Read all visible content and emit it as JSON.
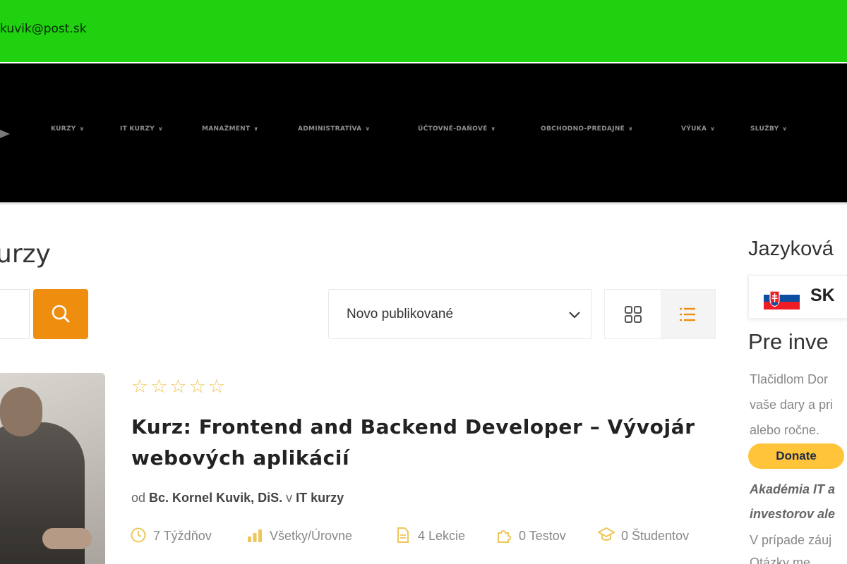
{
  "topbar": {
    "email": "kuvik@post.sk"
  },
  "nav": {
    "items": [
      {
        "label": "KURZY"
      },
      {
        "label": "IT KURZY"
      },
      {
        "label": "MANAŽMENT"
      },
      {
        "label": "ADMINISTRATÍVA"
      },
      {
        "label": "ÚČTOVNÉ-DAŇOVÉ"
      },
      {
        "label": "OBCHODNO-PREDAJNÉ"
      },
      {
        "label": "VÝUKA"
      },
      {
        "label": "SLUŽBY"
      }
    ],
    "chevron": "∨"
  },
  "main": {
    "title": "urzy",
    "sort": {
      "selected": "Novo publikované"
    }
  },
  "course": {
    "rating": 0,
    "rating_max": 5,
    "stars": "☆☆☆☆☆",
    "title": "Kurz: Frontend and Backend Developer – Vývojár webových aplikácií",
    "by_prefix": "od",
    "author": "Bc. Kornel Kuvik, DiS.",
    "in_prefix": "v",
    "category": "IT kurzy",
    "meta": [
      {
        "icon": "clock-icon",
        "text": "7 Týždňov"
      },
      {
        "icon": "level-bars-icon",
        "text": "Všetky/Úrovne"
      },
      {
        "icon": "document-icon",
        "text": "4 Lekcie"
      },
      {
        "icon": "puzzle-icon",
        "text": "0 Testov"
      },
      {
        "icon": "graduate-icon",
        "text": "0 Študentov"
      }
    ]
  },
  "sidebar": {
    "lang_title": "Jazyková",
    "lang_code": "SK",
    "investor_title": "Pre inve",
    "text_lines": [
      "Tlačidlom Dor",
      "vaše dary a pri",
      "alebo ročne."
    ],
    "donate_label": "Donate",
    "em_lines": [
      "Akadémia IT a",
      "investorov ale"
    ],
    "tail_lines": [
      "V prípade záuj",
      "Otázky me"
    ]
  },
  "colors": {
    "topbar": "#1fd10f",
    "nav": "#000000",
    "accent": "#ee8d0e",
    "star": "#efc65a",
    "donate": "#ffc439"
  }
}
